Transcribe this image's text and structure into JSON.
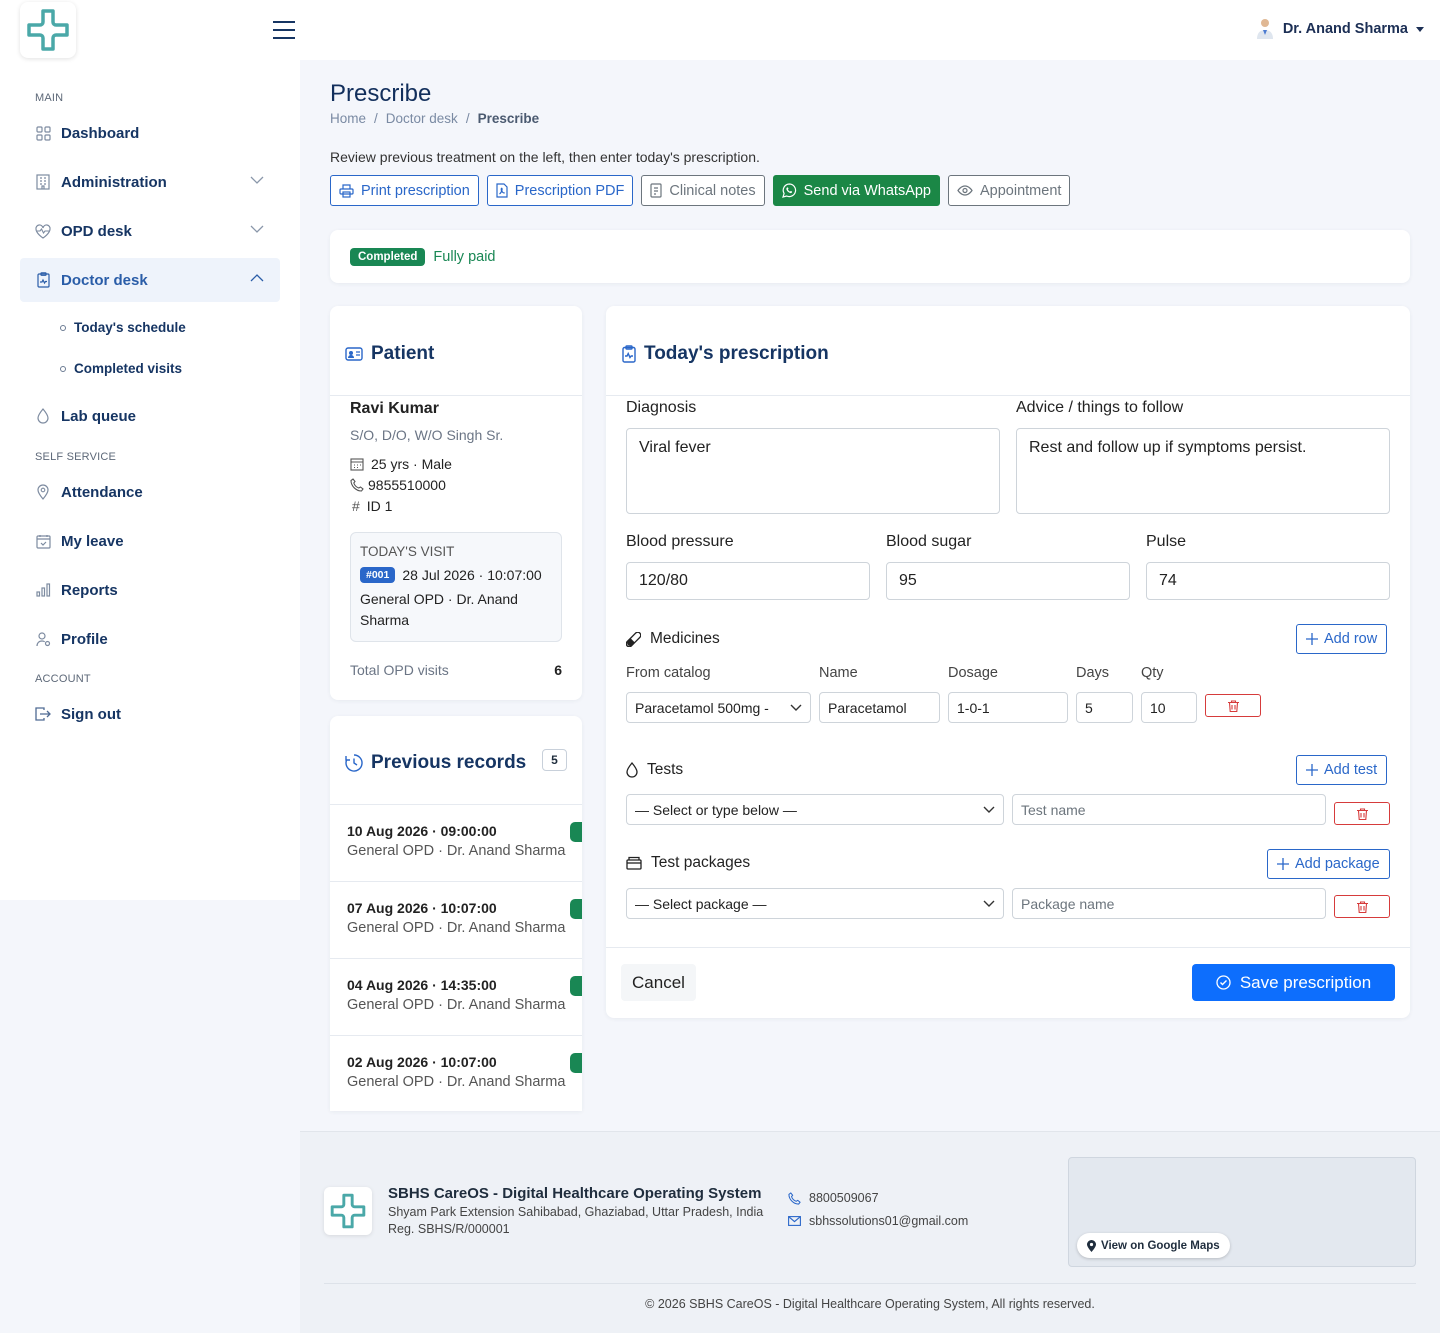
{
  "header": {
    "user_name": "Dr. Anand Sharma"
  },
  "sidebar": {
    "section_main": "MAIN",
    "section_self": "SELF SERVICE",
    "section_account": "ACCOUNT",
    "items": {
      "dashboard": "Dashboard",
      "administration": "Administration",
      "opd": "OPD desk",
      "doctor": "Doctor desk",
      "today_schedule": "Today's schedule",
      "completed_visits": "Completed visits",
      "lab": "Lab queue",
      "attendance": "Attendance",
      "leave": "My leave",
      "reports": "Reports",
      "profile": "Profile",
      "signout": "Sign out"
    }
  },
  "page": {
    "title": "Prescribe",
    "breadcrumb": [
      "Home",
      "Doctor desk",
      "Prescribe"
    ],
    "intro": "Review previous treatment on the left, then enter today's prescription.",
    "actions": {
      "print": "Print prescription",
      "pdf": "Prescription PDF",
      "notes": "Clinical notes",
      "whatsapp": "Send via WhatsApp",
      "appointment": "Appointment"
    },
    "status": {
      "badge": "Completed",
      "payment": "Fully paid"
    }
  },
  "patient": {
    "heading": "Patient",
    "name": "Ravi Kumar",
    "relation": "S/O, D/O, W/O Singh Sr.",
    "age_gender": "25 yrs · Male",
    "phone": "9855510000",
    "id": "ID 1",
    "visit": {
      "heading": "TODAY'S VISIT",
      "token": "#001",
      "datetime": "28 Jul 2026 · 10:07:00",
      "department": "General OPD · Dr. Anand Sharma"
    },
    "total_label": "Total OPD visits",
    "total_value": "6"
  },
  "records": {
    "heading": "Previous records",
    "count": "5",
    "items": [
      {
        "date": "10 Aug 2026 · 09:00:00",
        "meta": "General OPD · Dr. Anand Sharma"
      },
      {
        "date": "07 Aug 2026 · 10:07:00",
        "meta": "General OPD · Dr. Anand Sharma"
      },
      {
        "date": "04 Aug 2026 · 14:35:00",
        "meta": "General OPD · Dr. Anand Sharma"
      },
      {
        "date": "02 Aug 2026 · 10:07:00",
        "meta": "General OPD · Dr. Anand Sharma"
      }
    ]
  },
  "prescription": {
    "heading": "Today's prescription",
    "diagnosis_label": "Diagnosis",
    "diagnosis_value": "Viral fever",
    "advice_label": "Advice / things to follow",
    "advice_value": "Rest and follow up if symptoms persist.",
    "bp_label": "Blood pressure",
    "bp_value": "120/80",
    "sugar_label": "Blood sugar",
    "sugar_value": "95",
    "pulse_label": "Pulse",
    "pulse_value": "74",
    "medicines_label": "Medicines",
    "add_row": "Add row",
    "med_cols": {
      "catalog": "From catalog",
      "name": "Name",
      "dosage": "Dosage",
      "days": "Days",
      "qty": "Qty"
    },
    "med_row": {
      "catalog": "Paracetamol 500mg -",
      "name": "Paracetamol",
      "dosage": "1-0-1",
      "days": "5",
      "qty": "10"
    },
    "tests_label": "Tests",
    "add_test": "Add test",
    "test_select": "— Select or type below —",
    "test_placeholder": "Test name",
    "packages_label": "Test packages",
    "add_package": "Add package",
    "package_select": "— Select package —",
    "package_placeholder": "Package name",
    "cancel": "Cancel",
    "save": "Save prescription"
  },
  "footer": {
    "org": "SBHS CareOS - Digital Healthcare Operating System",
    "address": "Shyam Park Extension Sahibabad, Ghaziabad, Uttar Pradesh, India",
    "reg": "Reg. SBHS/R/000001",
    "phone": "8800509067",
    "email": "sbhssolutions01@gmail.com",
    "maps": "View on Google Maps",
    "copyright": "© 2026 SBHS CareOS - Digital Healthcare Operating System, All rights reserved."
  },
  "colors": {
    "primary": "#2a67c9",
    "navy": "#163563",
    "teal": "#4aa8a8",
    "success": "#198754",
    "danger": "#d63b3b"
  }
}
